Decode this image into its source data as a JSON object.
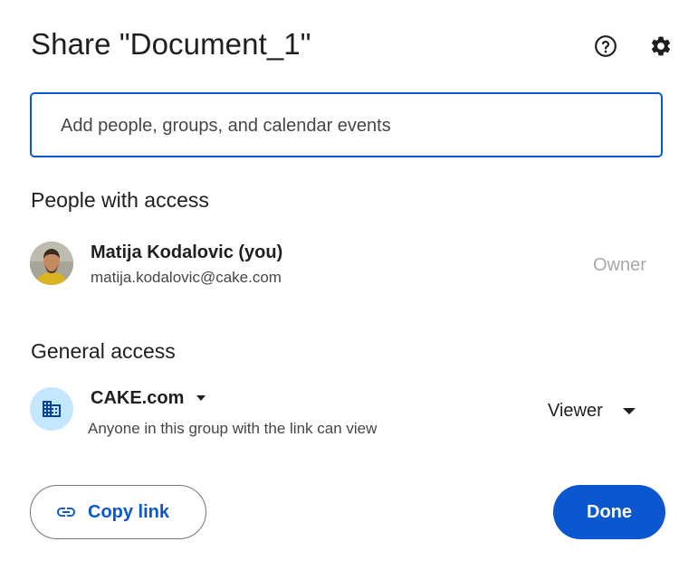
{
  "dialog": {
    "title": "Share \"Document_1\"",
    "help_icon": "help-circle-icon",
    "settings_icon": "gear-icon"
  },
  "search": {
    "placeholder": "Add people, groups, and calendar events",
    "value": ""
  },
  "people_with_access": {
    "heading": "People with access",
    "people": [
      {
        "name": "Matija Kodalovic (you)",
        "email": "matija.kodalovic@cake.com",
        "role": "Owner",
        "avatar": "user-photo"
      }
    ]
  },
  "general_access": {
    "heading": "General access",
    "org_icon": "building-icon",
    "org_name": "CAKE.com",
    "description": "Anyone in this group with the link can view",
    "role": "Viewer"
  },
  "footer": {
    "copy_link_label": "Copy link",
    "copy_link_icon": "link-icon",
    "done_label": "Done"
  },
  "colors": {
    "accent": "#0b57d0",
    "org_icon_bg": "#c2e7ff",
    "muted_role": "#a8a8a8"
  }
}
